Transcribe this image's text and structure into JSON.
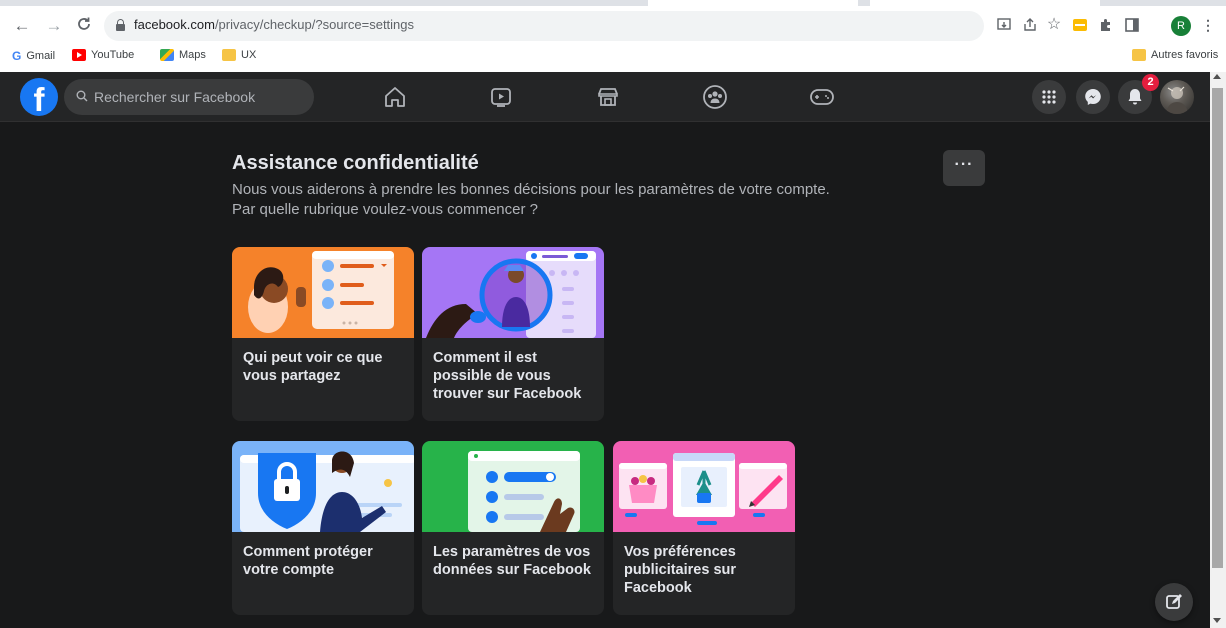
{
  "browser": {
    "url_host": "facebook.com",
    "url_path": "/privacy/checkup/?source=settings",
    "profile_initial": "R",
    "bookmarks": [
      {
        "label": "Gmail",
        "icon": "gmail-icon"
      },
      {
        "label": "YouTube",
        "icon": "youtube-icon"
      },
      {
        "label": "Maps",
        "icon": "maps-icon"
      },
      {
        "label": "UX",
        "icon": "folder-icon"
      }
    ],
    "other_bookmarks": "Autres favoris"
  },
  "header": {
    "logo": "f",
    "search_placeholder": "Rechercher sur Facebook",
    "tabs": [
      "home-icon",
      "watch-icon",
      "marketplace-icon",
      "groups-icon",
      "gaming-icon"
    ],
    "notifications_count": "2"
  },
  "page": {
    "title": "Assistance confidentialité",
    "subtitle_line1": "Nous vous aiderons à prendre les bonnes décisions pour les paramètres de votre compte.",
    "subtitle_line2": "Par quelle rubrique voulez-vous commencer ?",
    "more_label": "···"
  },
  "cards": [
    {
      "label": "Qui peut voir ce que vous partagez",
      "art_bg": "#f5822a"
    },
    {
      "label": "Comment il est possible de vous trouver sur Facebook",
      "art_bg": "#a576f5"
    },
    {
      "label": "Comment protéger votre compte",
      "art_bg": "#7ab3f8"
    },
    {
      "label": "Les paramètres de vos données sur Facebook",
      "art_bg": "#27b34a"
    },
    {
      "label": "Vos préférences publicitaires sur Facebook",
      "art_bg": "#f25fb3"
    }
  ]
}
